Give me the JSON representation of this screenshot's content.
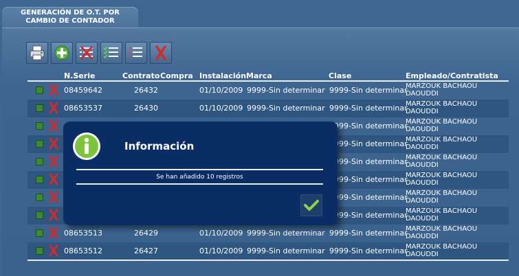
{
  "tab": {
    "title": "GENERACIÓN DE O.T. POR\nCAMBIO DE CONTADOR"
  },
  "toolbar": {
    "buttons": [
      {
        "name": "print-button",
        "icon": "printer-icon"
      },
      {
        "name": "add-button",
        "icon": "plus-circle-icon"
      },
      {
        "name": "remove-list-button",
        "icon": "list-x-icon"
      },
      {
        "name": "check-list-button",
        "icon": "list-check-icon"
      },
      {
        "name": "list-button",
        "icon": "list-icon"
      },
      {
        "name": "delete-button",
        "icon": "red-x-icon"
      }
    ]
  },
  "table": {
    "headers": {
      "serie": "N.Serie",
      "contrato": "Contrato",
      "compra": "Compra",
      "instalacion": "Instalación",
      "marca": "Marca",
      "clase": "Clase",
      "empleado": "Empleado/Contratista"
    },
    "rows": [
      {
        "serie": "08459642",
        "contrato": "26432",
        "instalacion": "01/10/2009",
        "marca": "9999-Sin determinar",
        "clase": "9999-Sin determinar",
        "empleado": "MARZOUK BACHAOU\nDAOUDDI"
      },
      {
        "serie": "08653537",
        "contrato": "26430",
        "instalacion": "01/10/2009",
        "marca": "9999-Sin determinar",
        "clase": "9999-Sin determinar",
        "empleado": "MARZOUK BACHAOU\nDAOUDDI"
      },
      {
        "serie": "",
        "contrato": "",
        "instalacion": "",
        "marca": "",
        "clase": "9999-Sin determinar",
        "empleado": "MARZOUK BACHAOU\nDAOUDDI"
      },
      {
        "serie": "",
        "contrato": "",
        "instalacion": "",
        "marca": "",
        "clase": "9999-Sin determinar",
        "empleado": "MARZOUK BACHAOU\nDAOUDDI"
      },
      {
        "serie": "",
        "contrato": "",
        "instalacion": "",
        "marca": "",
        "clase": "9999-Sin determinar",
        "empleado": "MARZOUK BACHAOU\nDAOUDDI"
      },
      {
        "serie": "",
        "contrato": "",
        "instalacion": "",
        "marca": "",
        "clase": "9999-Sin determinar",
        "empleado": "MARZOUK BACHAOU\nDAOUDDI"
      },
      {
        "serie": "",
        "contrato": "",
        "instalacion": "",
        "marca": "",
        "clase": "9999-Sin determinar",
        "empleado": "MARZOUK BACHAOU\nDAOUDDI"
      },
      {
        "serie": "",
        "contrato": "",
        "instalacion": "",
        "marca": "",
        "clase": "9999-Sin determinar",
        "empleado": "MARZOUK BACHAOU\nDAOUDDI"
      },
      {
        "serie": "08653513",
        "contrato": "26429",
        "instalacion": "01/10/2009",
        "marca": "9999-Sin determinar",
        "clase": "9999-Sin determinar",
        "empleado": "MARZOUK BACHAOU\nDAOUDDI"
      },
      {
        "serie": "08653512",
        "contrato": "26427",
        "instalacion": "01/10/2009",
        "marca": "9999-Sin determinar",
        "clase": "9999-Sin determinar",
        "empleado": "MARZOUK BACHAOU\nDAOUDDI"
      }
    ]
  },
  "modal": {
    "title": "Información",
    "message": "Se han añadido 10 registros",
    "icon": "info-icon",
    "ok_icon": "checkmark-icon"
  },
  "colors": {
    "background": "#3f6690",
    "modal": "#0b2d66",
    "row_alt": "#2f5680",
    "select_green": "#3a8a2e",
    "delete_red": "#d42a2a"
  }
}
